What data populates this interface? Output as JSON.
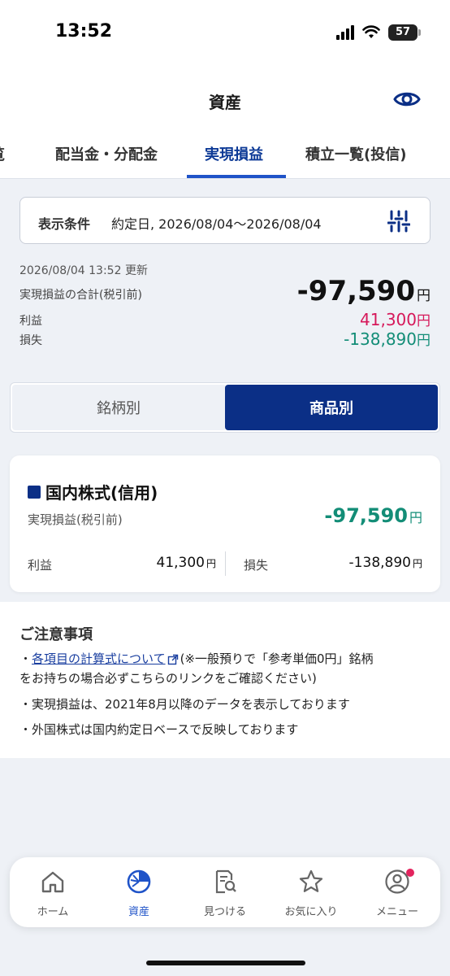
{
  "status": {
    "time": "13:52",
    "battery": "57"
  },
  "header": {
    "title": "資産",
    "eye_icon": "eye-icon"
  },
  "tabs": [
    {
      "label": "一覧"
    },
    {
      "label": "配当金・分配金"
    },
    {
      "label": "実現損益",
      "active": true
    },
    {
      "label": "積立一覧(投信)"
    }
  ],
  "condition": {
    "label": "表示条件",
    "value": "約定日, 2026/08/04〜2026/08/04",
    "icon": "filter-sliders-icon"
  },
  "summary": {
    "updated": "2026/08/04 13:52 更新",
    "total_label": "実現損益の合計(税引前)",
    "total_value": "-97,590",
    "yen": "円",
    "profit_label": "利益",
    "profit_value": "41,300",
    "loss_label": "損失",
    "loss_value": "-138,890"
  },
  "toggle": {
    "left": "銘柄別",
    "right": "商品別",
    "selected": "商品別"
  },
  "card": {
    "title": "国内株式(信用)",
    "sub_label": "実現損益(税引前)",
    "total": "-97,590",
    "yen": "円",
    "profit_label": "利益",
    "profit_value": "41,300",
    "loss_label": "損失",
    "loss_value": "-138,890"
  },
  "notes": {
    "title": "ご注意事項",
    "link_text": "各項目の計算式について",
    "item1_rest_line1": "(※一般預りで「参考単価0円」銘柄",
    "item1_rest_line2": "をお持ちの場合必ずこちらのリンクをご確認ください)",
    "item2": "実現損益は、2021年8月以降のデータを表示しております",
    "item3": "外国株式は国内約定日ベースで反映しております",
    "bullet": "・"
  },
  "nav": [
    {
      "label": "ホーム",
      "icon": "home-icon"
    },
    {
      "label": "資産",
      "icon": "pie-chart-icon",
      "active": true
    },
    {
      "label": "見つける",
      "icon": "search-document-icon"
    },
    {
      "label": "お気に入り",
      "icon": "star-icon"
    },
    {
      "label": "メニュー",
      "icon": "user-icon",
      "badge": true
    }
  ],
  "colors": {
    "primary": "#0b2f86",
    "accent_tab": "#1f53c8",
    "profit": "#d6185a",
    "loss": "#138d77"
  }
}
